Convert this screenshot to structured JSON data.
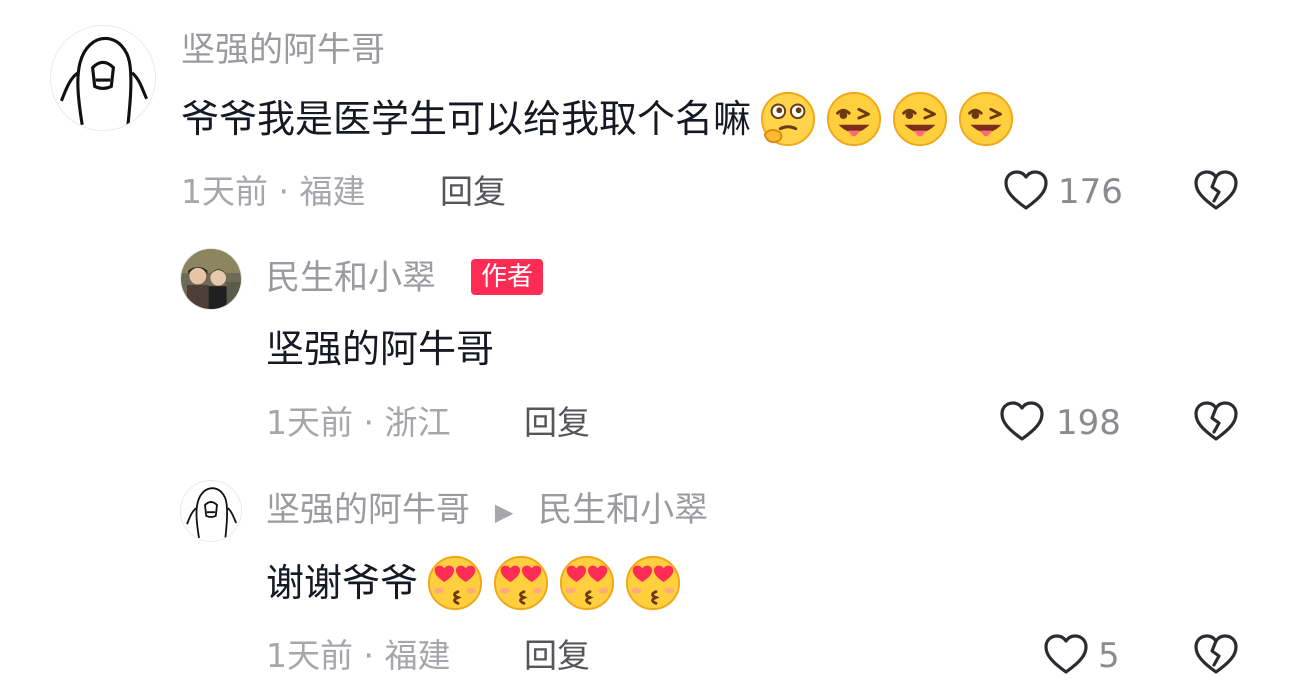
{
  "comments": [
    {
      "username": "坚强的阿牛哥",
      "text": "爷爷我是医学生可以给我取个名嘛",
      "emojis": [
        "thinking-face-icon",
        "wink-tongue-icon",
        "wink-tongue-icon",
        "wink-tongue-icon"
      ],
      "time": "1天前",
      "location": "福建",
      "reply_label": "回复",
      "likes": "176"
    },
    {
      "username": "民生和小翠",
      "badge": "作者",
      "text": "坚强的阿牛哥",
      "time": "1天前",
      "location": "浙江",
      "reply_label": "回复",
      "likes": "198"
    },
    {
      "username": "坚强的阿牛哥",
      "reply_to": "民生和小翠",
      "text": "谢谢爷爷",
      "emojis": [
        "heart-eyes-icon",
        "heart-eyes-icon",
        "heart-eyes-icon",
        "heart-eyes-icon"
      ],
      "time": "1天前",
      "location": "福建",
      "reply_label": "回复",
      "likes": "5"
    }
  ],
  "separator": "·",
  "colors": {
    "accent": "#fe2c55",
    "text": "#161823",
    "muted": "#9a9a9f"
  }
}
